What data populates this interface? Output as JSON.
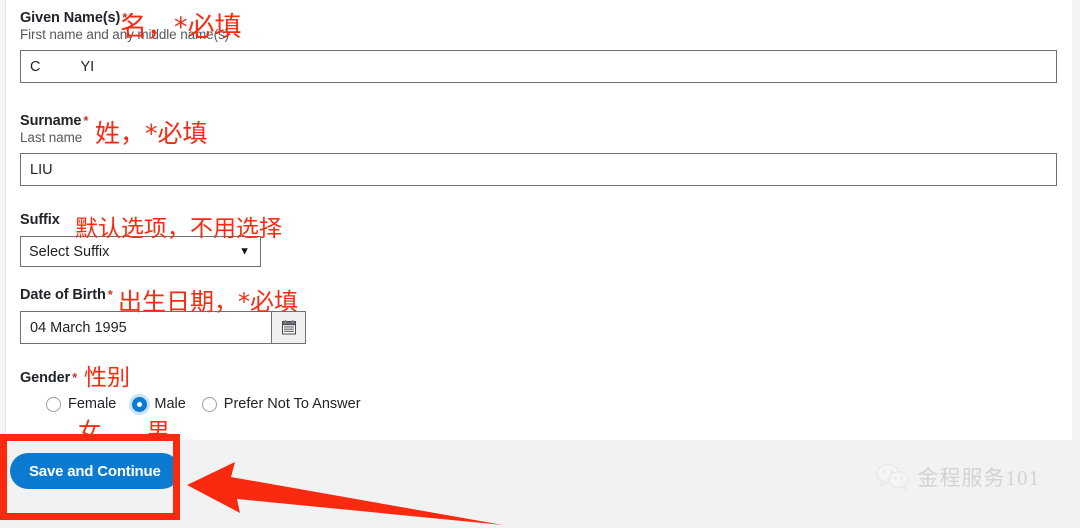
{
  "form": {
    "fields": [
      {
        "key": "given_name",
        "label": "Given Name(s)",
        "required_mark": "*",
        "sublabel": "First name and any middle name(s)",
        "value": "C          YI",
        "annotation": "名，*必填"
      },
      {
        "key": "surname",
        "label": "Surname",
        "required_mark": "*",
        "sublabel": "Last name",
        "value": "LIU",
        "annotation": "姓，*必填"
      },
      {
        "key": "suffix",
        "label": "Suffix",
        "required_mark": "",
        "sublabel": "",
        "value": "Select Suffix",
        "annotation": "默认选项，不用选择"
      },
      {
        "key": "date_of_birth",
        "label": "Date of Birth",
        "required_mark": "*",
        "sublabel": "",
        "value": "04 March 1995",
        "annotation": "出生日期，*必填"
      },
      {
        "key": "gender",
        "label": "Gender",
        "required_mark": "*",
        "sublabel": "",
        "value": "Male",
        "annotation": "性别"
      }
    ],
    "gender_options": [
      {
        "label": "Female",
        "selected": false,
        "annotation": "女"
      },
      {
        "label": "Male",
        "selected": true,
        "annotation": "男"
      },
      {
        "label": "Prefer Not To Answer",
        "selected": false,
        "annotation": ""
      }
    ],
    "select_caret": "▼",
    "calendar_icon": "calendar-icon"
  },
  "footer": {
    "save_button": "Save and Continue"
  },
  "watermark": {
    "icon": "wechat-icon",
    "text": "金程服务101"
  },
  "colors": {
    "accent_blue": "#0b7ad1",
    "annotation_red": "#fa2a10",
    "required_star": "#c8372d",
    "footer_bg": "#f2f2f2",
    "input_border": "#707070"
  }
}
